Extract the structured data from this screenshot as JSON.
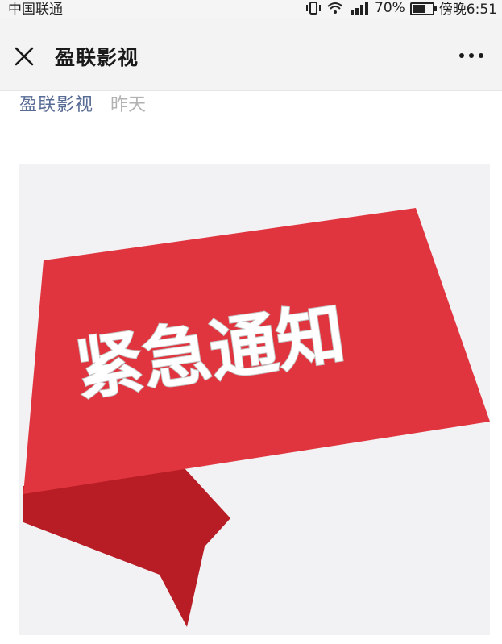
{
  "status_bar": {
    "carrier": "中国联通",
    "battery_percent": "70%",
    "battery_level": 0.7,
    "time": "傍晚6:51"
  },
  "nav": {
    "title": "盈联影视",
    "close_icon": "close-icon",
    "more_icon": "more-horizontal-icon"
  },
  "article": {
    "author": "盈联影视",
    "date": "昨天",
    "image": {
      "banner_text": "紧急通知",
      "banner_color": "#e0353f",
      "banner_dark_color": "#b81d25",
      "background_color": "#f2f2f4"
    }
  }
}
